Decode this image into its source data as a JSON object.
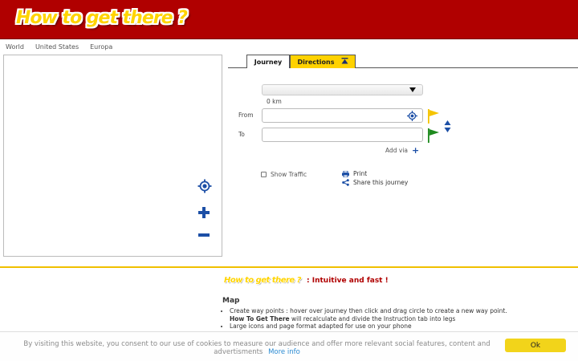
{
  "header": {
    "logo_text": "How to get there ?"
  },
  "region_nav": [
    {
      "label": "World"
    },
    {
      "label": "United States"
    },
    {
      "label": "Europa"
    }
  ],
  "tabs": {
    "journey": "Journey",
    "directions": "Directions"
  },
  "route": {
    "select_value": "",
    "distance": "0 km",
    "from_label": "From",
    "from_value": "",
    "to_label": "To",
    "to_value": "",
    "add_via": "Add via",
    "show_traffic": "Show Traffic",
    "print": "Print",
    "share": "Share this journey"
  },
  "info": {
    "logo_text": "How to get there ?",
    "tagline": ": Intuitive and fast !",
    "section_title": "Map",
    "bullet1_a": "Create way points : hover over journey then click and drag circle to create a new way point.",
    "bullet1_b_bold": "How To Get There",
    "bullet1_b_rest": " will recalculate and divide the Instruction tab into legs",
    "bullet2": "Large icons and page format adapted for use on your phone"
  },
  "cookie": {
    "text": "By visiting this website, you consent to our use of cookies to measure our audience and offer more relevant social features, content and advertisments",
    "more_info": "More info",
    "ok": "Ok"
  },
  "colors": {
    "header_bg": "#b00000",
    "accent_yellow": "#ffd200",
    "icon_blue": "#1c4fa6",
    "flag_yellow": "#f5c400",
    "flag_green": "#1e8a1e"
  }
}
